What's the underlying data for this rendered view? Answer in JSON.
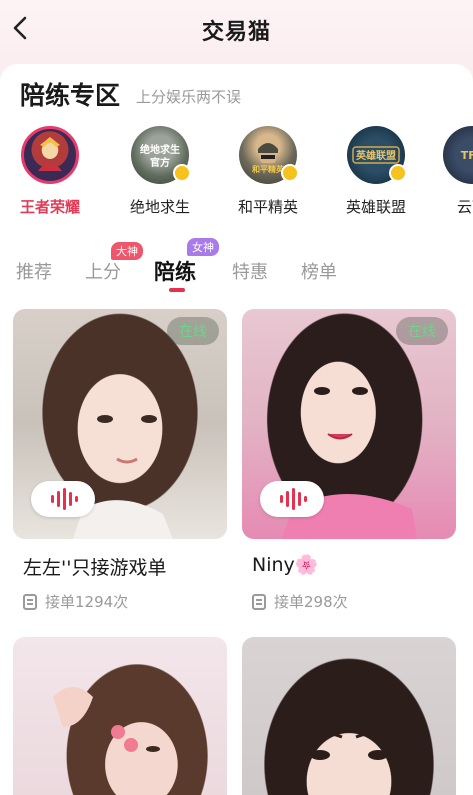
{
  "header": {
    "title": "交易猫"
  },
  "section": {
    "title": "陪练专区",
    "subtitle": "上分娱乐两不误"
  },
  "games": [
    {
      "label": "王者荣耀",
      "icon": "honor-of-kings-icon",
      "active": true
    },
    {
      "label": "绝地求生",
      "icon": "pubg-icon",
      "active": false
    },
    {
      "label": "和平精英",
      "icon": "peace-elite-icon",
      "active": false
    },
    {
      "label": "英雄联盟",
      "icon": "league-of-legends-icon",
      "active": false
    },
    {
      "label": "云顶",
      "icon": "tft-icon",
      "active": false
    }
  ],
  "tabs": [
    {
      "label": "推荐"
    },
    {
      "label": "上分",
      "tag": "大神"
    },
    {
      "label": "陪练",
      "tag": "女神",
      "active": true
    },
    {
      "label": "特惠"
    },
    {
      "label": "榜单"
    }
  ],
  "players": [
    {
      "name": "左左''只接游戏单",
      "orders": "接单1294次",
      "status": "在线"
    },
    {
      "name": "Niny🌸",
      "orders": "接单298次",
      "status": "在线"
    },
    {
      "name": "",
      "orders": "",
      "status": ""
    },
    {
      "name": "",
      "orders": "",
      "status": ""
    }
  ],
  "colors": {
    "accent": "#e6304d",
    "online": "#6fd38a",
    "tag_red": "#f0566b",
    "tag_purple": "#a87be8"
  }
}
